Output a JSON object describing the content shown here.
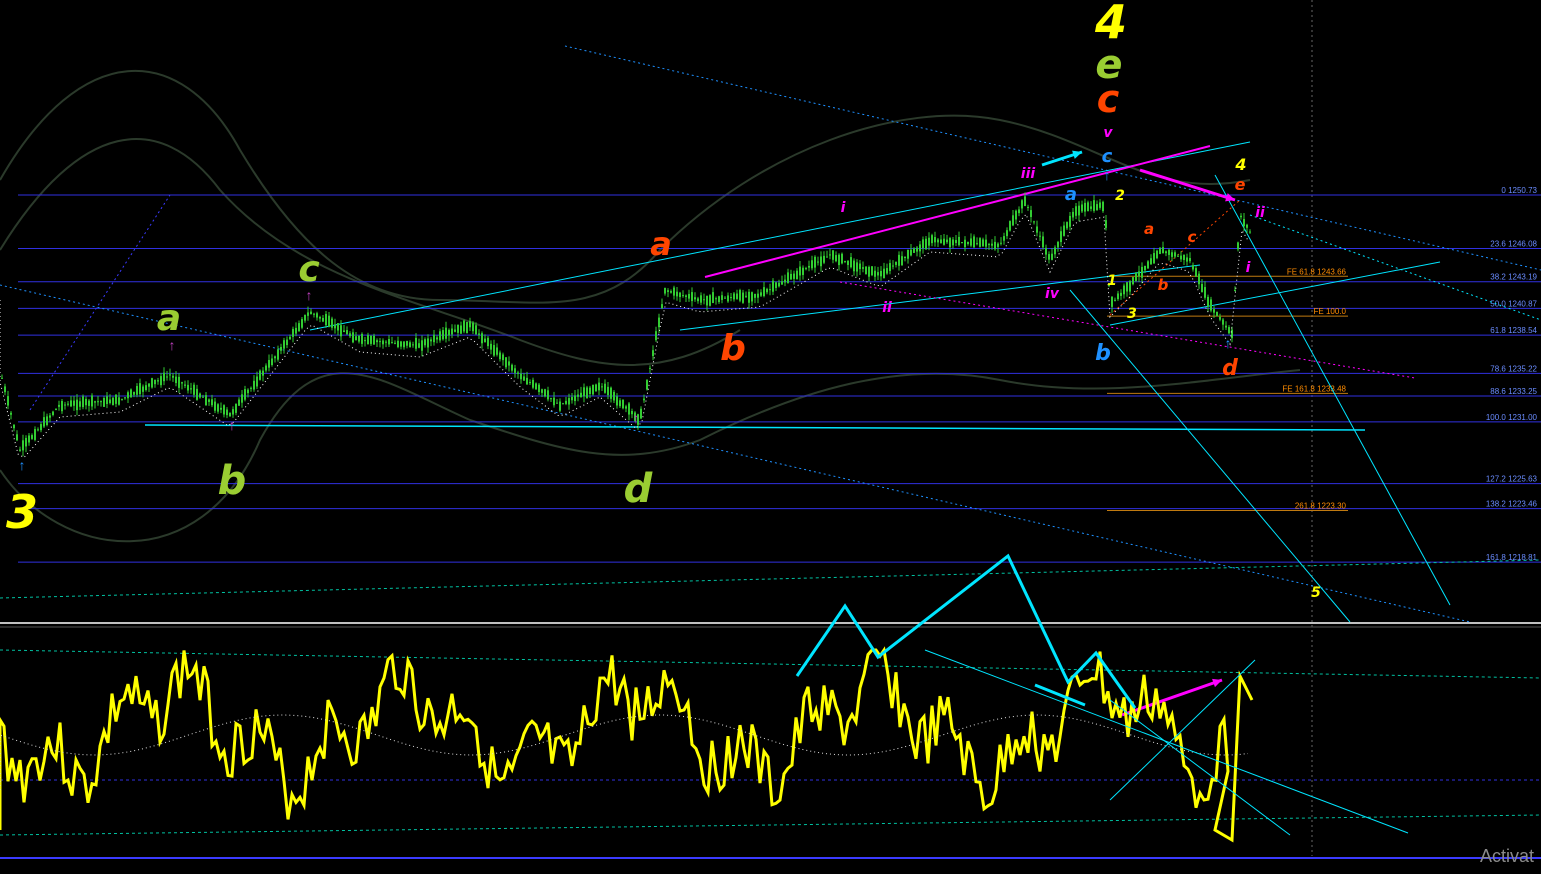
{
  "chart_data": {
    "type": "line",
    "instrument_panel": "price candlesticks with Elliott wave labels, Fibonacci retracement and expansion levels",
    "fib_levels": [
      {
        "text": "0 1250.73",
        "value": 1250.73
      },
      {
        "text": "23.6 1246.08",
        "value": 1246.08
      },
      {
        "text": "38.2 1243.19",
        "value": 1243.19
      },
      {
        "text": "50.0 1240.87",
        "value": 1240.87
      },
      {
        "text": "61.8 1238.54",
        "value": 1238.54
      },
      {
        "text": "78.6 1235.22",
        "value": 1235.22
      },
      {
        "text": "88.6 1233.25",
        "value": 1233.25
      },
      {
        "text": "100.0 1231.00",
        "value": 1231.0
      },
      {
        "text": "127.2 1225.63",
        "value": 1225.63
      },
      {
        "text": "138.2 1223.46",
        "value": 1223.46
      },
      {
        "text": "161.8 1218.81",
        "value": 1218.81
      }
    ],
    "fe_levels": [
      {
        "text": "FE 61.8 1243.66",
        "value": 1243.66
      },
      {
        "text": "FE 100.0",
        "value": 1240.2
      },
      {
        "text": "FE 161.8 1233.48",
        "value": 1233.48
      },
      {
        "text": "261.8 1223.30",
        "value": 1223.3
      }
    ],
    "wave_labels": [
      {
        "text": "3",
        "color": "#ffff00",
        "size": 46
      },
      {
        "text": "a",
        "color": "#9acd32",
        "size": 36
      },
      {
        "text": "b",
        "color": "#9acd32",
        "size": 40
      },
      {
        "text": "c",
        "color": "#9acd32",
        "size": 36
      },
      {
        "text": "d",
        "color": "#9acd32",
        "size": 40
      },
      {
        "text": "a",
        "color": "#ff4500",
        "size": 32
      },
      {
        "text": "b",
        "color": "#ff4500",
        "size": 36
      },
      {
        "text": "4",
        "color": "#ffff00",
        "size": 46
      },
      {
        "text": "e",
        "color": "#9acd32",
        "size": 40
      },
      {
        "text": "c",
        "color": "#ff4500",
        "size": 38
      },
      {
        "text": "v",
        "color": "#ff00ff",
        "size": 14
      },
      {
        "text": "c",
        "color": "#1e90ff",
        "size": 18
      },
      {
        "text": "iii",
        "color": "#ff00ff",
        "size": 14
      },
      {
        "text": "i",
        "color": "#ff00ff",
        "size": 14
      },
      {
        "text": "ii",
        "color": "#ff00ff",
        "size": 14
      },
      {
        "text": "iv",
        "color": "#ff00ff",
        "size": 14
      },
      {
        "text": "a",
        "color": "#1e90ff",
        "size": 18
      },
      {
        "text": "b",
        "color": "#1e90ff",
        "size": 22
      },
      {
        "text": "2",
        "color": "#ffff00",
        "size": 14
      },
      {
        "text": "1",
        "color": "#ffff00",
        "size": 14
      },
      {
        "text": "3",
        "color": "#ffff00",
        "size": 14
      },
      {
        "text": "a",
        "color": "#ff4500",
        "size": 15
      },
      {
        "text": "b",
        "color": "#ff4500",
        "size": 15
      },
      {
        "text": "c",
        "color": "#ff4500",
        "size": 15
      },
      {
        "text": "d",
        "color": "#ff4500",
        "size": 22
      },
      {
        "text": "4",
        "color": "#ffff00",
        "size": 16
      },
      {
        "text": "e",
        "color": "#ff4500",
        "size": 16
      },
      {
        "text": "ii",
        "color": "#ff00ff",
        "size": 14
      },
      {
        "text": "i",
        "color": "#ff00ff",
        "size": 14
      },
      {
        "text": "5",
        "color": "#ffff00",
        "size": 14
      }
    ],
    "watermark": "Activat",
    "colors": {
      "background": "#000000",
      "candles": "#32cd32",
      "fib_line": "#3a3aff",
      "fib_text": "#6a8cff",
      "fe_text": "#ff8c00",
      "oscillator": "#ffff00",
      "trend_cyan": "#00e5ff",
      "trend_magenta": "#ff00ff"
    }
  }
}
